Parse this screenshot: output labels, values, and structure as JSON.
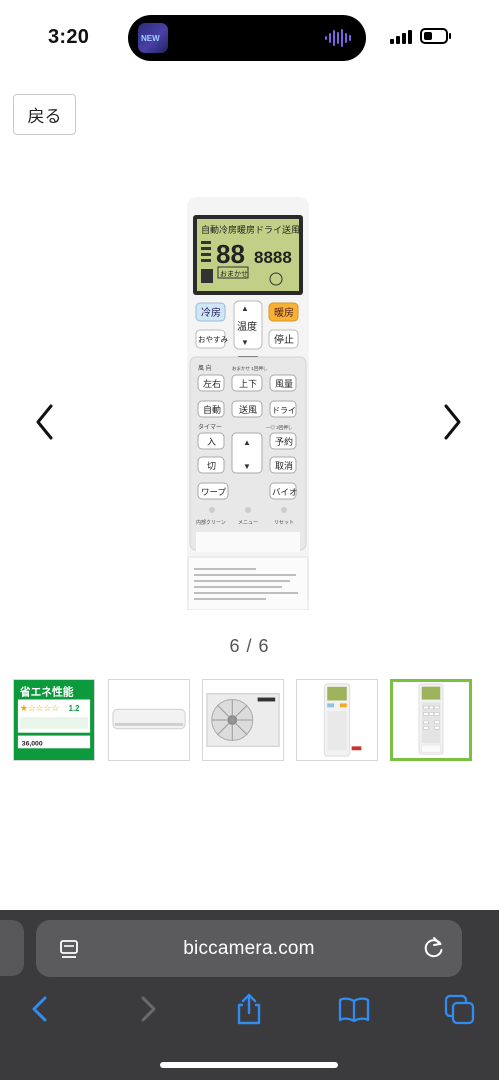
{
  "status": {
    "time": "3:20",
    "island_art_text": "NEW"
  },
  "page": {
    "back_label": "戻る",
    "counter": "6 / 6"
  },
  "remote": {
    "lcd_top": "自動冷房暖房ドライ送風",
    "lcd_digits": "88",
    "lcd_clock": "8888",
    "lcd_mode": "おまかせ",
    "btn_cool": "冷房",
    "btn_heat": "暖房",
    "btn_temp": "温度",
    "btn_sleep": "おやすみ",
    "btn_stop": "停止",
    "label_direction": "風 向",
    "label_direction_sub": "おまかせ  1回押し",
    "btn_leftright": "左右",
    "btn_updown": "上下",
    "btn_volume": "風量",
    "btn_auto": "自動",
    "btn_fan": "送風",
    "btn_dry": "ドライ",
    "label_timer": "タイマー",
    "label_timer_sub": "—◎ 3回押し",
    "btn_on": "入",
    "btn_reserve": "予約",
    "btn_off": "切",
    "btn_cancel": "取消",
    "btn_warp": "ワープ",
    "btn_bio": "バイオ",
    "label_clean": "内部クリーン",
    "label_menu": "メニュー",
    "label_reset": "リセット"
  },
  "thumbnails": {
    "t1_title": "省エネ性能",
    "t1_rating": "1.2",
    "t1_price": "36,000"
  },
  "browser": {
    "url": "biccamera.com"
  },
  "colors": {
    "accent_active_thumb": "#7ac143",
    "safari_bg": "#3b3b3d",
    "link_blue": "#2f8cf0"
  }
}
